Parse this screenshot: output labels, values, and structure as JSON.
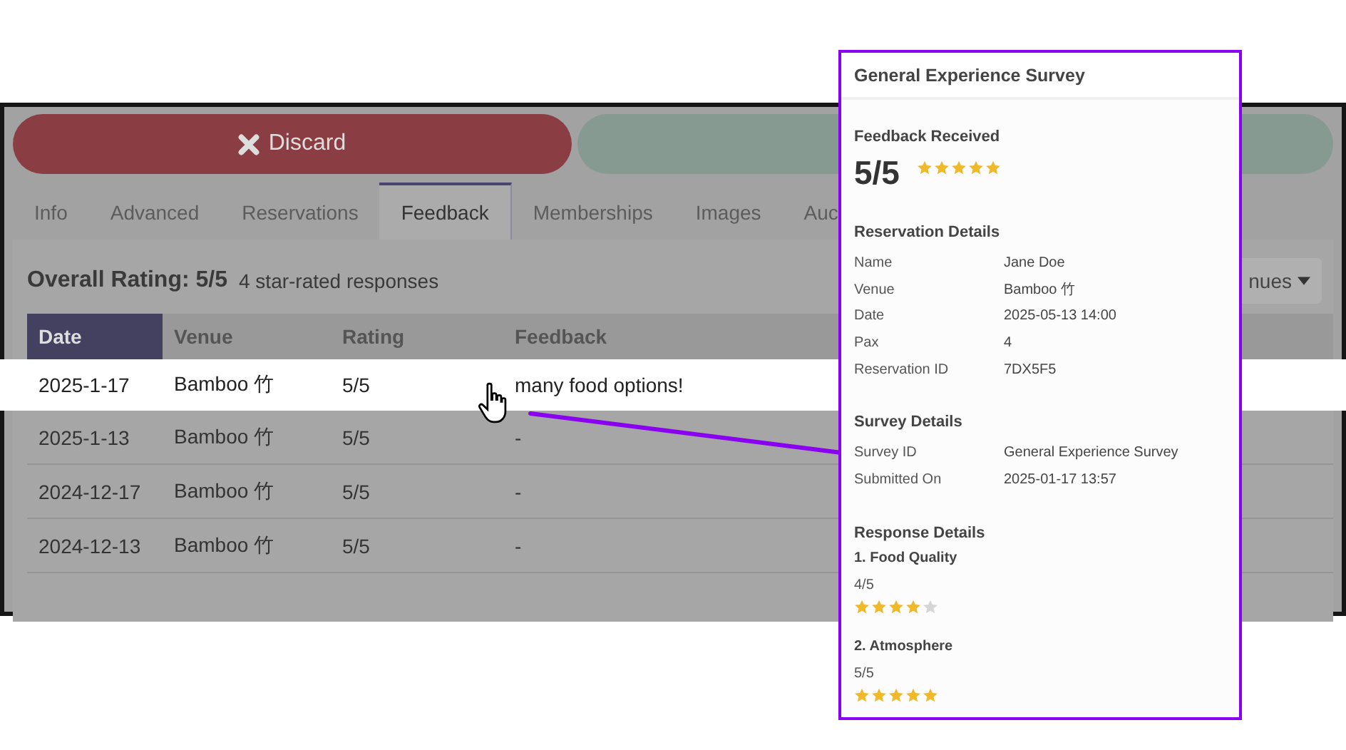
{
  "action_buttons": [
    {
      "kind": "discard",
      "label": "Discard"
    },
    {
      "kind": "save"
    }
  ],
  "tabs": [
    {
      "label": "Info",
      "selected": false
    },
    {
      "label": "Advanced",
      "selected": false
    },
    {
      "label": "Reservations",
      "selected": false
    },
    {
      "label": "Feedback",
      "selected": true
    },
    {
      "label": "Memberships",
      "selected": false
    },
    {
      "label": "Images",
      "selected": false
    },
    {
      "label": "Auc",
      "selected": false
    }
  ],
  "summary": {
    "title": "Overall Rating: 5/5",
    "count": "4 star-rated responses"
  },
  "filter": {
    "value": "nues"
  },
  "table": {
    "columns": [
      {
        "label": "Date",
        "selected": true
      },
      {
        "label": "Venue",
        "selected": false
      },
      {
        "label": "Rating",
        "selected": false
      },
      {
        "label": "Feedback",
        "selected": false
      }
    ],
    "rows": [
      {
        "cells": [
          "2025-1-17",
          "Bamboo 竹",
          "5/5",
          "many food options!"
        ],
        "selected": true
      },
      {
        "cells": [
          "2025-1-13",
          "Bamboo 竹",
          "5/5",
          "-"
        ],
        "selected": false
      },
      {
        "cells": [
          "2024-12-17",
          "Bamboo 竹",
          "5/5",
          "-"
        ],
        "selected": false
      },
      {
        "cells": [
          "2024-12-13",
          "Bamboo 竹",
          "5/5",
          "-"
        ],
        "selected": false
      }
    ]
  },
  "popup": {
    "title": "General Experience Survey",
    "feedback_heading": "Feedback Received",
    "score": "5/5",
    "stars": 5,
    "sections": [
      {
        "heading": "Reservation Details",
        "fields": [
          {
            "label": "Name",
            "value": "Jane Doe"
          },
          {
            "label": "Venue",
            "value": "Bamboo 竹"
          },
          {
            "label": "Date",
            "value": "2025-05-13 14:00"
          },
          {
            "label": "Pax",
            "value": "4"
          },
          {
            "label": "Reservation ID",
            "value": "7DX5F5"
          }
        ]
      },
      {
        "heading": "Survey Details",
        "fields": [
          {
            "label": "Survey ID",
            "value": "General Experience Survey"
          },
          {
            "label": "Submitted On",
            "value": "2025-01-17 13:57"
          }
        ]
      }
    ],
    "responses_heading": "Response Details",
    "responses": [
      {
        "question": "1. Food Quality",
        "score": "4/5",
        "stars": 4
      },
      {
        "question": "2. Atmosphere",
        "score": "5/5",
        "stars": 5
      }
    ]
  }
}
